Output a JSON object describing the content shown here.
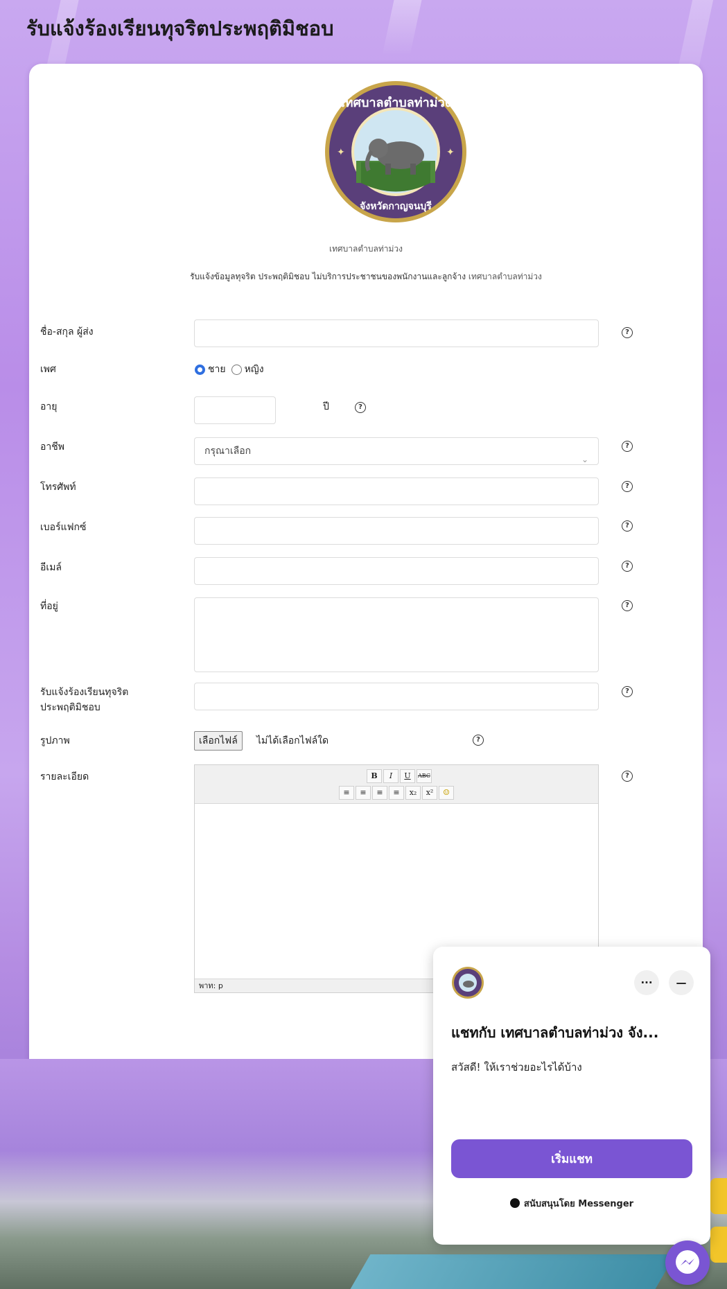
{
  "page": {
    "title": "รับแจ้งร้องเรียนทุจริตประพฤติมิชอบ"
  },
  "header": {
    "org_name": "เทศบาลตำบลท่าม่วง",
    "description_main": "รับแจ้งข้อมูลทุจริต ประพฤติมิชอบ ไม่บริการประชาชนของพนักงานและลูกจ้าง",
    "description_org": "เทศบาลตำบลท่าม่วง",
    "logo_text_top": "เทศบาลตำบลท่าม่วง",
    "logo_text_bottom": "จังหวัดกาญจนบุรี"
  },
  "form": {
    "name_label": "ชื่อ-สกุล ผู้ส่ง",
    "gender_label": "เพศ",
    "gender_male": "ชาย",
    "gender_female": "หญิง",
    "gender_selected": "ชาย",
    "age_label": "อายุ",
    "age_unit": "ปี",
    "occupation_label": "อาชีพ",
    "occupation_selected": "กรุณาเลือก",
    "phone_label": "โทรศัพท์",
    "fax_label": "เบอร์แฟกซ์",
    "email_label": "อีเมล์",
    "address_label": "ที่อยู่",
    "complaint_label_line1": "รับแจ้งร้องเรียนทุจริต",
    "complaint_label_line2": "ประพฤติมิชอบ",
    "image_label": "รูปภาพ",
    "file_button": "เลือกไฟล์",
    "file_status": "ไม่ได้เลือกไฟล์ใด",
    "detail_label": "รายละเอียด",
    "help_glyph": "?",
    "editor": {
      "toolbar_row1": [
        "B",
        "I",
        "U",
        "ABC"
      ],
      "toolbar_row2": [
        "≡",
        "≡",
        "≡",
        "≡",
        "x₂",
        "x²",
        "☺"
      ],
      "status_path": "พาท: p"
    }
  },
  "chat": {
    "title": "แชทกับ เทศบาลตำบลท่าม่วง จัง...",
    "greeting": "สวัสดี! ให้เราช่วยอะไรได้บ้าง",
    "start_button": "เริ่มแชท",
    "footer": "สนับสนุนโดย Messenger",
    "more": "···",
    "minimize": "—"
  },
  "colors": {
    "accent": "#7a55d3",
    "radio": "#2f6fe0",
    "background": "#c19bec"
  }
}
